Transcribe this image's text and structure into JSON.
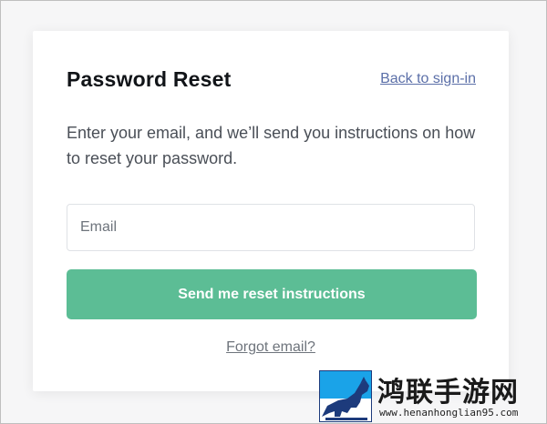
{
  "header": {
    "title": "Password Reset",
    "back_link": "Back to sign-in"
  },
  "description": "Enter your email, and we’ll send you instructions on how to reset your password.",
  "form": {
    "email_placeholder": "Email",
    "email_value": "",
    "submit_label": "Send me reset instructions"
  },
  "footer": {
    "forgot_link": "Forgot email?"
  },
  "watermark": {
    "brand": "鸿联手游网",
    "url": "www.henanhonglian95.com",
    "icon": "horse-logo-icon"
  },
  "colors": {
    "accent": "#5cbd95",
    "link": "#5b6fa8",
    "text": "#111418",
    "muted": "#6e747c"
  }
}
